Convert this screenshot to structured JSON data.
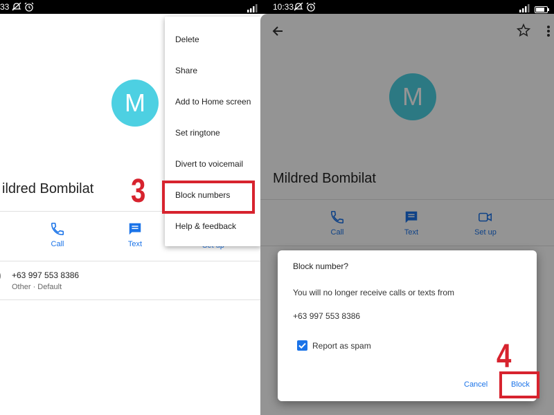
{
  "colors": {
    "avatar": "#4dd0e2",
    "accent": "#1a73e8",
    "highlight": "#d7232e",
    "scrim": "#000000"
  },
  "left": {
    "status": {
      "time": "33",
      "icons": [
        "mute-icon",
        "alarm-icon",
        "signal-icon",
        "battery-icon"
      ]
    },
    "avatar_letter": "M",
    "contact_name": "ildred Bombilat",
    "actions": [
      {
        "label": "Call",
        "icon": "phone-icon"
      },
      {
        "label": "Text",
        "icon": "message-icon"
      },
      {
        "label": "Set up",
        "icon": "video-icon"
      }
    ],
    "phone": {
      "number": "+63 997 553 8386",
      "sub": "Other · Default"
    },
    "menu": {
      "items": [
        "Delete",
        "Share",
        "Add to Home screen",
        "Set ringtone",
        "Divert to voicemail",
        "Block numbers",
        "Help & feedback"
      ],
      "highlighted": "Block numbers"
    },
    "step_label": "3"
  },
  "right": {
    "status": {
      "time": "10:33",
      "icons": [
        "mute-icon",
        "alarm-icon",
        "signal-icon",
        "battery-icon"
      ]
    },
    "toolbar_icons": [
      "back-arrow-icon",
      "star-icon",
      "more-vert-icon"
    ],
    "avatar_letter": "M",
    "contact_name": "Mildred Bombilat",
    "actions": [
      {
        "label": "Call",
        "icon": "phone-icon"
      },
      {
        "label": "Text",
        "icon": "message-icon"
      },
      {
        "label": "Set up",
        "icon": "video-icon"
      }
    ],
    "dialog": {
      "title": "Block number?",
      "message": "You will no longer receive calls or texts from",
      "number": "+63 997 553 8386",
      "checkbox_label": "Report as spam",
      "checkbox_checked": true,
      "cancel_label": "Cancel",
      "block_label": "Block"
    },
    "step_label": "4"
  }
}
